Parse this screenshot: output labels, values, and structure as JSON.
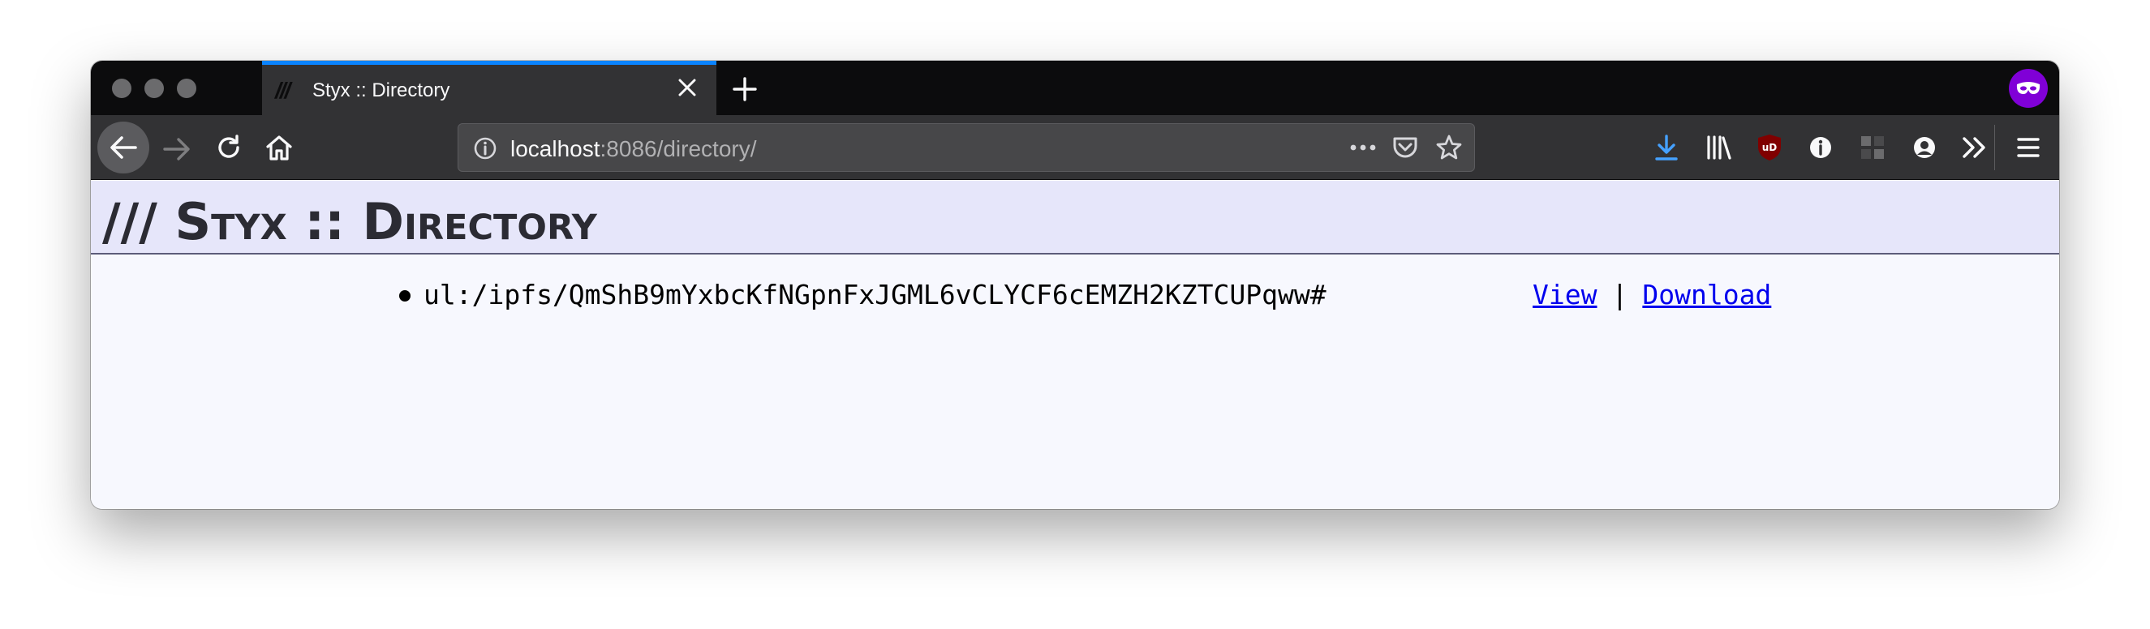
{
  "browser": {
    "tab": {
      "favicon_text": "///",
      "title": "Styx :: Directory"
    },
    "urlbar": {
      "host": "localhost",
      "rest": ":8086/directory/"
    },
    "icons": {
      "back": "back-arrow-icon",
      "forward": "forward-arrow-icon",
      "reload": "reload-icon",
      "home": "home-icon",
      "info": "info-icon",
      "more": "more-horizontal-icon",
      "pocket": "pocket-icon",
      "star": "bookmark-star-icon",
      "download": "download-icon",
      "library": "library-icon",
      "ublock": "ublock-shield-icon",
      "extension_info": "extension-info-icon",
      "extension_grid": "extension-grid-icon",
      "account": "account-icon",
      "overflow": "overflow-chevrons-icon",
      "menu": "hamburger-menu-icon",
      "private": "private-browsing-mask-icon"
    },
    "colors": {
      "accent": "#0a84ff",
      "private": "#8000d7",
      "ublock": "#800000"
    }
  },
  "page": {
    "title": "/// Styx :: Directory",
    "entries": [
      {
        "name": "ul:/ipfs/QmShB9mYxbcKfNGpnFxJGML6vCLYCF6cEMZH2KZTCUPqww#",
        "view_label": "View",
        "separator": "|",
        "download_label": "Download"
      }
    ]
  }
}
